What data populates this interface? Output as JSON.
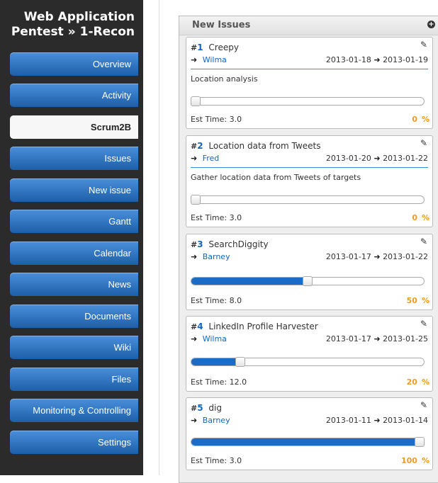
{
  "sidebar": {
    "project_title_line1": "Web Application",
    "project_title_line2": "Pentest » 1-Recon",
    "items": [
      {
        "label": "Overview"
      },
      {
        "label": "Activity"
      },
      {
        "label": "Scrum2B"
      },
      {
        "label": "Issues"
      },
      {
        "label": "New issue"
      },
      {
        "label": "Gantt"
      },
      {
        "label": "Calendar"
      },
      {
        "label": "News"
      },
      {
        "label": "Documents"
      },
      {
        "label": "Wiki"
      },
      {
        "label": "Files"
      },
      {
        "label": "Monitoring & Controlling"
      },
      {
        "label": "Settings"
      }
    ],
    "active_item": "Scrum2B"
  },
  "panel": {
    "title": "New Issues",
    "add_icon": "plus-circle-icon"
  },
  "issues": [
    {
      "hash": "#",
      "number": "1",
      "subject": "Creepy",
      "assignee": "Wilma",
      "start": "2013-01-18",
      "due": "2013-01-19",
      "description": "Location analysis",
      "est_label": "Est Time: 3.0",
      "progress": "0",
      "pct_sign": "%",
      "progress_fraction": 0.0
    },
    {
      "hash": "#",
      "number": "2",
      "subject": "Location data from Tweets",
      "assignee": "Fred",
      "start": "2013-01-20",
      "due": "2013-01-22",
      "description": "Gather location data from Tweets of targets",
      "est_label": "Est Time: 3.0",
      "progress": "0",
      "pct_sign": "%",
      "progress_fraction": 0.0
    },
    {
      "hash": "#",
      "number": "3",
      "subject": "SearchDiggity",
      "assignee": "Barney",
      "start": "2013-01-17",
      "due": "2013-01-22",
      "description": "",
      "est_label": "Est Time: 8.0",
      "progress": "50",
      "pct_sign": "%",
      "progress_fraction": 0.5
    },
    {
      "hash": "#",
      "number": "4",
      "subject": "LinkedIn Profile Harvester",
      "assignee": "Wilma",
      "start": "2013-01-17",
      "due": "2013-01-25",
      "description": "",
      "est_label": "Est Time: 12.0",
      "progress": "20",
      "pct_sign": "%",
      "progress_fraction": 0.2
    },
    {
      "hash": "#",
      "number": "5",
      "subject": "dig",
      "assignee": "Barney",
      "start": "2013-01-11",
      "due": "2013-01-14",
      "description": "",
      "est_label": "Est Time: 3.0",
      "progress": "100",
      "pct_sign": "%",
      "progress_fraction": 1.0
    }
  ],
  "colors": {
    "sidebar_bg": "#2b2b2b",
    "nav_button": "#2f74c0",
    "link": "#1565c0",
    "percent": "#f39a21",
    "progress_fill": "#1b6cc6",
    "rule": "#3b8fd8"
  },
  "icons": {
    "edit": "edit-icon",
    "arrow": "arrow-right-icon"
  }
}
